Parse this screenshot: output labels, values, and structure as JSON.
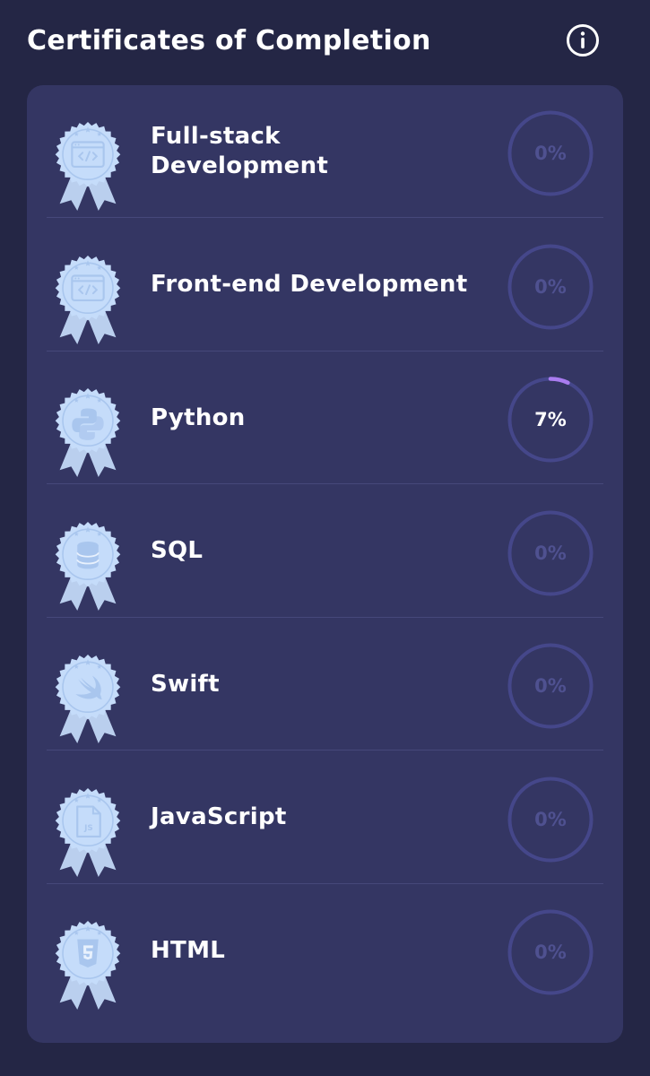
{
  "header": {
    "title": "Certificates of Completion",
    "info_icon": "info-circle-icon"
  },
  "colors": {
    "background": "#242645",
    "card": "#343663",
    "divider": "#46487a",
    "ring_track": "#45478a",
    "ring_progress": "#a97cf0",
    "badge_fill": "#c5dcfa",
    "badge_accent": "#a9c6ee",
    "text": "#ffffff",
    "text_muted": "#4f5190"
  },
  "certificates": [
    {
      "name": "Full-stack\nDevelopment",
      "percent_label": "0%",
      "progress": 0,
      "badge_icon": "code-window-icon"
    },
    {
      "name": "Front-end Development",
      "percent_label": "0%",
      "progress": 0,
      "badge_icon": "code-window-icon"
    },
    {
      "name": "Python",
      "percent_label": "7%",
      "progress": 7,
      "badge_icon": "python-icon"
    },
    {
      "name": "SQL",
      "percent_label": "0%",
      "progress": 0,
      "badge_icon": "database-icon"
    },
    {
      "name": "Swift",
      "percent_label": "0%",
      "progress": 0,
      "badge_icon": "swift-icon"
    },
    {
      "name": "JavaScript",
      "percent_label": "0%",
      "progress": 0,
      "badge_icon": "js-file-icon"
    },
    {
      "name": "HTML",
      "percent_label": "0%",
      "progress": 0,
      "badge_icon": "html5-icon"
    }
  ]
}
